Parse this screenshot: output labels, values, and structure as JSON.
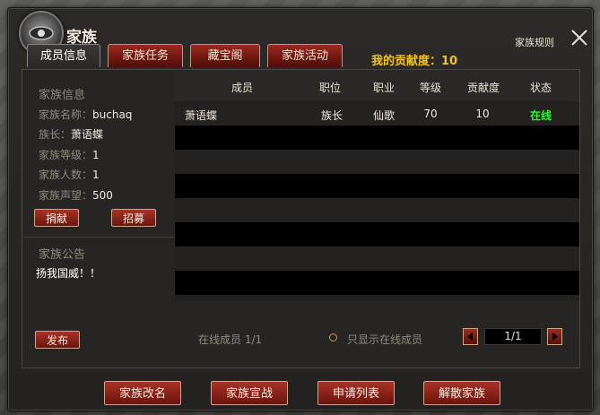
{
  "window": {
    "title": "家族",
    "rules_link": "家族规则"
  },
  "tabs": [
    {
      "label": "成员信息",
      "active": true
    },
    {
      "label": "家族任务",
      "active": false
    },
    {
      "label": "藏宝阁",
      "active": false
    },
    {
      "label": "家族活动",
      "active": false
    }
  ],
  "contribution": {
    "label": "我的贡献度：10"
  },
  "clan_info": {
    "section_title": "家族信息",
    "name_label": "家族名称：",
    "name_value": "buchaq",
    "leader_label": "族长：",
    "leader_value": "萧语蝶",
    "level_label": "家族等级：",
    "level_value": "1",
    "members_label": "家族人数：",
    "members_value": "1",
    "prestige_label": "家族声望：",
    "prestige_value": "500",
    "donate_button": "捐献",
    "recruit_button": "招募"
  },
  "announcement": {
    "section_title": "家族公告",
    "text": "扬我国威！！",
    "publish_button": "发布"
  },
  "members_table": {
    "headers": [
      "成员",
      "职位",
      "职业",
      "等级",
      "贡献度",
      "状态"
    ],
    "rows": [
      {
        "name": "萧语蝶",
        "position": "族长",
        "profession": "仙歌",
        "level": "70",
        "contribution": "10",
        "status": "在线"
      }
    ]
  },
  "footer": {
    "online_members": "在线成员 1/1",
    "online_only_label": "只显示在线成员",
    "page": "1/1"
  },
  "bottom_buttons": {
    "rename": "家族改名",
    "declare_war": "家族宣战",
    "applications": "申请列表",
    "dissolve": "解散家族"
  },
  "colors": {
    "accent_gold": "#f5c518",
    "online_green": "#20ff20",
    "button_red": "#a83226"
  },
  "icons": [
    "clan-emblem-icon",
    "close-icon",
    "page-prev-icon",
    "page-next-icon",
    "radio-icon"
  ]
}
